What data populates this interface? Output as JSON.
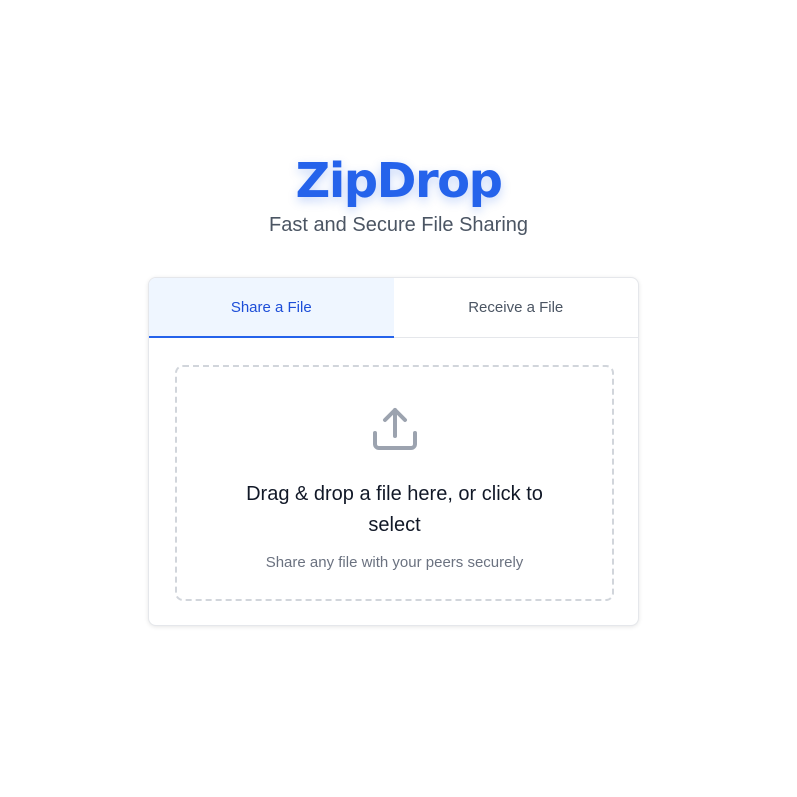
{
  "header": {
    "brand": "ZipDrop",
    "tagline": "Fast and Secure File Sharing"
  },
  "tabs": [
    {
      "label": "Share a File",
      "active": true
    },
    {
      "label": "Receive a File",
      "active": false
    }
  ],
  "dropzone": {
    "icon": "upload-icon",
    "title": "Drag & drop a file here, or click to select",
    "subtitle": "Share any file with your peers securely"
  },
  "colors": {
    "accent": "#2563eb",
    "active_tab_bg": "#eff6ff",
    "muted_text": "#6b7280",
    "icon_gray": "#9ca3af"
  }
}
